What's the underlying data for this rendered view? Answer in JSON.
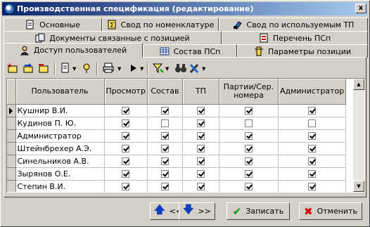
{
  "window": {
    "title": "Производственная спецификация (редактирование)",
    "close_label": "x"
  },
  "tabs": {
    "row1": [
      {
        "label": "Основные",
        "icon": "document-icon"
      },
      {
        "label": "Свод по номенклатуре",
        "icon": "sum-icon"
      },
      {
        "label": "Свод по используемым ТП",
        "icon": "tools-icon"
      }
    ],
    "row2": [
      {
        "label": "Документы связанные с позицией",
        "icon": "linked-docs-icon"
      },
      {
        "label": "Перечень ПСп",
        "icon": "list-icon"
      }
    ],
    "row3": [
      {
        "label": "Доступ пользователей",
        "icon": "user-icon",
        "active": true
      },
      {
        "label": "Состав ПСп",
        "icon": "grid-icon"
      },
      {
        "label": "Параметры позиции",
        "icon": "params-icon"
      }
    ]
  },
  "toolbar": [
    "add-row-icon",
    "copy-row-icon",
    "delete-row-icon",
    "document-dropdown-icon",
    "pin-icon",
    "print-dropdown-icon",
    "play-dropdown-icon",
    "filter-dropdown-icon",
    "binoculars-icon",
    "tools-dropdown-icon"
  ],
  "grid": {
    "columns": [
      "Пользователь",
      "Просмотр",
      "Состав",
      "ТП",
      "Партии/Сер. номера",
      "Администратор"
    ],
    "rows": [
      {
        "user": "Кушнир В.И.",
        "view": true,
        "composition": true,
        "tp": true,
        "batches": true,
        "admin": true,
        "current": true
      },
      {
        "user": "Кудинов П. Ю.",
        "view": true,
        "composition": false,
        "tp": true,
        "batches": false,
        "admin": false
      },
      {
        "user": "Администратор",
        "view": true,
        "composition": true,
        "tp": true,
        "batches": true,
        "admin": true
      },
      {
        "user": "Штейнбрехер А.Э.",
        "view": true,
        "composition": true,
        "tp": true,
        "batches": true,
        "admin": true
      },
      {
        "user": "Синельников А.В.",
        "view": true,
        "composition": true,
        "tp": true,
        "batches": true,
        "admin": true
      },
      {
        "user": "Зырянов О.Е.",
        "view": true,
        "composition": true,
        "tp": true,
        "batches": true,
        "admin": true
      },
      {
        "user": "Степин В.И.",
        "view": true,
        "composition": true,
        "tp": true,
        "batches": true,
        "admin": true
      }
    ]
  },
  "buttons": {
    "prev_label": "<<",
    "next_label": ">>",
    "save_label": "Записать",
    "cancel_label": "Отменить"
  },
  "colors": {
    "title_start": "#0a246a",
    "title_end": "#a6caf0",
    "save_icon": "#00a000",
    "cancel_icon": "#d00000",
    "nav_arrow": "#1040c0"
  }
}
